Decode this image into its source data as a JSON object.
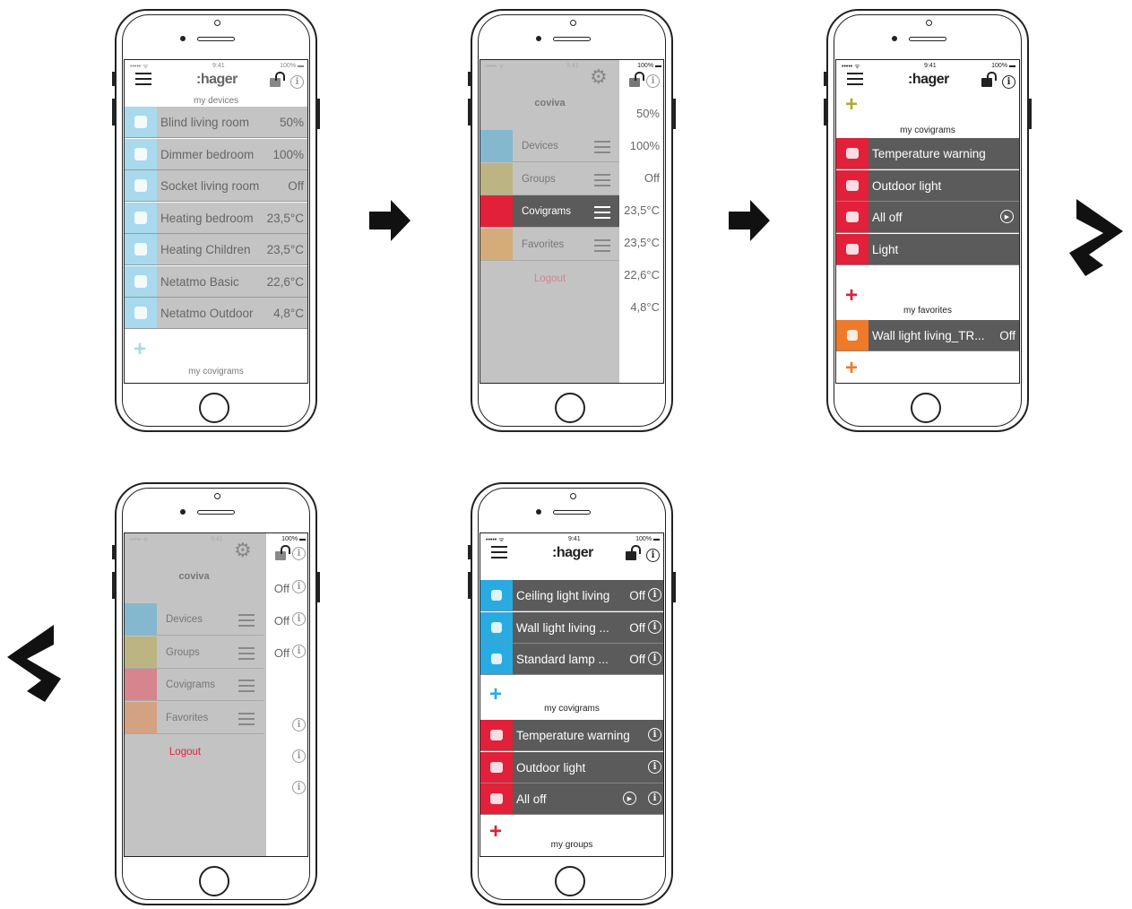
{
  "common": {
    "status_signal": "••••• ᯤ",
    "status_time": "9:41",
    "status_battery": "100% ▬",
    "logo": ":hager",
    "info_glyph": "i",
    "plus_glyph": "+",
    "coviva": "coviva",
    "logout": "Logout",
    "gear_glyph": "⚙",
    "play_glyph": "▶"
  },
  "colors": {
    "blue": "#29abe2",
    "red": "#e2203a",
    "orange": "#ee7a2a",
    "olive": "#b4a934",
    "menu_devices": "#84b8cf",
    "menu_groups": "#bcb583",
    "menu_covigrams": "#e2203a",
    "menu_covigrams_faded": "#d6848e",
    "menu_favorites": "#d3ac7a",
    "menu_favorites2": "#d3a283",
    "light_blue_icon": "#a8d9ec"
  },
  "screen1": {
    "section_top": "my devices",
    "section_bottom": "my covigrams",
    "rows": [
      {
        "label": "Blind living room",
        "value": "50%"
      },
      {
        "label": "Dimmer bedroom",
        "value": "100%"
      },
      {
        "label": "Socket living room",
        "value": "Off"
      },
      {
        "label": "Heating bedroom",
        "value": "23,5°C"
      },
      {
        "label": "Heating Children",
        "value": "23,5°C"
      },
      {
        "label": "Netatmo Basic",
        "value": "22,6°C"
      },
      {
        "label": "Netatmo Outdoor",
        "value": "4,8°C"
      }
    ]
  },
  "screen2": {
    "menu": [
      "Devices",
      "Groups",
      "Covigrams",
      "Favorites"
    ],
    "right_values": [
      "50%",
      "100%",
      "Off",
      "23,5°C",
      "23,5°C",
      "22,6°C",
      "4,8°C"
    ]
  },
  "screen3": {
    "section_covigrams": "my covigrams",
    "covigrams": [
      "Temperature warning",
      "Outdoor light",
      "All off",
      "Light"
    ],
    "section_favorites": "my favorites",
    "favorite": {
      "label": "Wall light living_TR...",
      "value": "Off"
    }
  },
  "screen4": {
    "menu": [
      "Devices",
      "Groups",
      "Covigrams",
      "Favorites"
    ],
    "right_values": [
      "Off",
      "Off",
      "Off"
    ]
  },
  "screen5": {
    "devices": [
      {
        "label": "Ceiling light living",
        "value": "Off"
      },
      {
        "label": "Wall light living ...",
        "value": "Off"
      },
      {
        "label": "Standard lamp ...",
        "value": "Off"
      }
    ],
    "section_covigrams": "my covigrams",
    "covigrams": [
      "Temperature warning",
      "Outdoor light",
      "All off"
    ],
    "section_groups": "my groups"
  }
}
